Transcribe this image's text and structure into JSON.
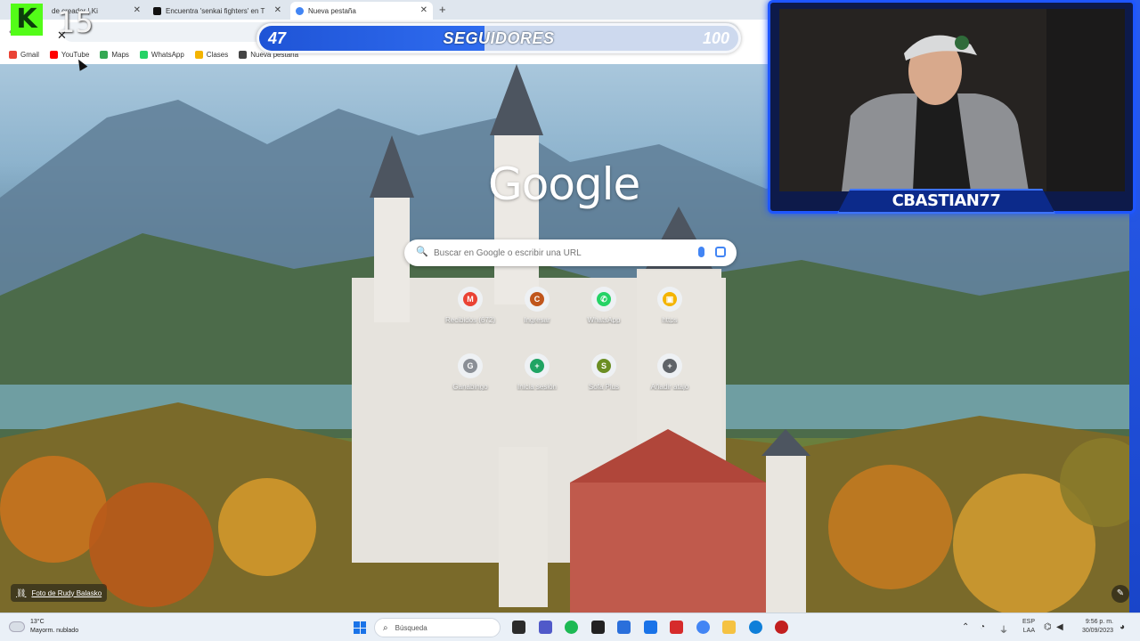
{
  "browser": {
    "tabs": [
      {
        "title": "de creador | Ki",
        "icon": "kick-favicon",
        "color": "#53fc18"
      },
      {
        "title": "Encuentra 'senkai fighters' en T",
        "icon": "tiktok-favicon",
        "color": "#111111"
      },
      {
        "title": "Nueva pestaña",
        "icon": "chrome-favicon",
        "color": "#4285f4"
      }
    ],
    "new_tab": "+",
    "close": "✕"
  },
  "bookmarks": [
    {
      "label": "Gmail",
      "icon": "gmail-icon",
      "color": "#ea4335"
    },
    {
      "label": "YouTube",
      "icon": "youtube-icon",
      "color": "#ff0000"
    },
    {
      "label": "Maps",
      "icon": "maps-icon",
      "color": "#34a853"
    },
    {
      "label": "WhatsApp",
      "icon": "whatsapp-icon",
      "color": "#25d366"
    },
    {
      "label": "Clases",
      "icon": "classroom-icon",
      "color": "#f4b400"
    },
    {
      "label": "Nueva pestaña",
      "icon": "chrome-icon",
      "color": "#444444"
    }
  ],
  "overlay": {
    "kick_count": "15",
    "followers": {
      "current": "47",
      "label": "SEGUIDORES",
      "goal": "100",
      "progress_fraction": 0.47
    },
    "streamer_name": "CBASTIAN77"
  },
  "ntp": {
    "logo": "Google",
    "search_placeholder": "Buscar en Google o escribir una URL",
    "shortcuts": [
      {
        "label": "Recibidos (672)",
        "letter": "M",
        "color": "#ea4335"
      },
      {
        "label": "Ingresar",
        "letter": "C",
        "color": "#c0561c"
      },
      {
        "label": "WhatsApp",
        "letter": "✆",
        "color": "#25d366"
      },
      {
        "label": "https",
        "letter": "▣",
        "color": "#f4b400"
      },
      {
        "label": "Ganabingo",
        "letter": "G",
        "color": "#8a8f96"
      },
      {
        "label": "Inicia sesión",
        "letter": "+",
        "color": "#1fa463"
      },
      {
        "label": "Sofa Plus",
        "letter": "S",
        "color": "#6b8e23"
      },
      {
        "label": "Añadir atajo",
        "letter": "+",
        "color": "#5f6368"
      }
    ],
    "photo_credit": "Foto de Rudy Balasko"
  },
  "taskbar": {
    "weather_temp": "13°C",
    "weather_desc": "Mayorm. nublado",
    "search_label": "Búsqueda",
    "language": "ESP",
    "language_sub": "LAA",
    "time": "9:56 p. m.",
    "date": "30/09/2023",
    "apps": [
      {
        "icon": "file-explorer-icon",
        "color": "#2b2b2b"
      },
      {
        "icon": "teams-icon",
        "color": "#5059c9"
      },
      {
        "icon": "spotify-icon",
        "color": "#1db954"
      },
      {
        "icon": "capcut-icon",
        "color": "#222222"
      },
      {
        "icon": "store-icon",
        "color": "#2a6fdb"
      },
      {
        "icon": "l-app-icon",
        "color": "#1a73e8"
      },
      {
        "icon": "shield-app-icon",
        "color": "#d62b2b"
      },
      {
        "icon": "chrome-icon",
        "color": "#4285f4"
      },
      {
        "icon": "folder-icon",
        "color": "#f5c242"
      },
      {
        "icon": "edge-icon",
        "color": "#0f7fd9"
      },
      {
        "icon": "obs-icon",
        "color": "#c21f1f"
      }
    ]
  }
}
